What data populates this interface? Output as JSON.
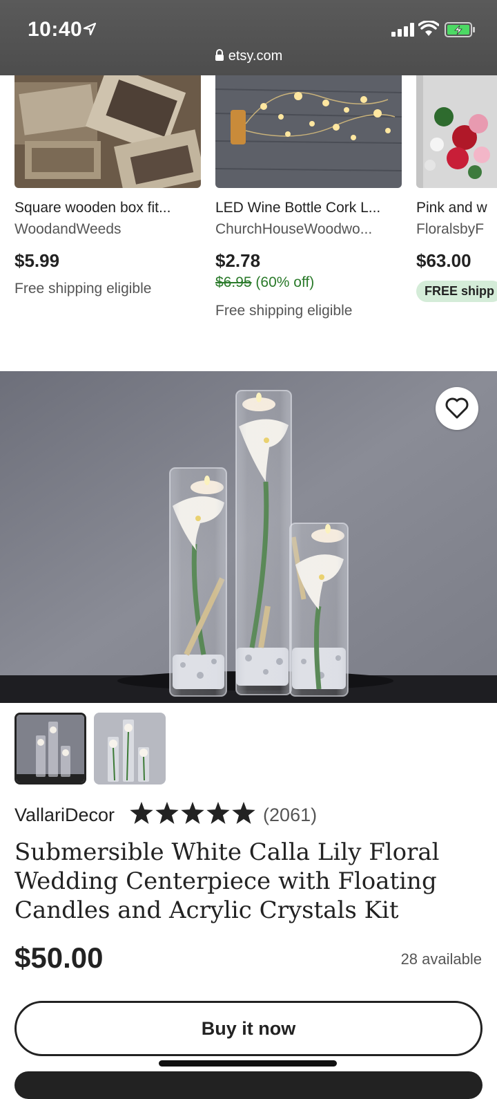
{
  "status_bar": {
    "time": "10:40",
    "url": "etsy.com"
  },
  "carousel": [
    {
      "title": "Square wooden box fit...",
      "shop": "WoodandWeeds",
      "price": "$5.99",
      "shipping": "Free shipping eligible"
    },
    {
      "title": "LED Wine Bottle Cork L...",
      "shop": "ChurchHouseWoodwo...",
      "price": "$2.78",
      "original_price": "$6.95",
      "discount": "(60% off)",
      "shipping": "Free shipping eligible"
    },
    {
      "title": "Pink and w",
      "shop": "FloralsbyF",
      "price": "$63.00",
      "badge": "FREE shipp"
    }
  ],
  "product": {
    "shop": "VallariDecor",
    "rating": 5,
    "reviews": "(2061)",
    "title": "Submersible White Calla Lily Floral Wedding Centerpiece with Floating Candles and Acrylic Crystals Kit",
    "price": "$50.00",
    "availability": "28 available",
    "buy_label": "Buy it now"
  },
  "icons": {
    "favorite": "heart-outline-icon",
    "lock": "lock-icon",
    "star": "star-icon"
  },
  "colors": {
    "discount_green": "#2a7a2a",
    "badge_bg": "#d4ecd8",
    "topbar": "#505050"
  }
}
